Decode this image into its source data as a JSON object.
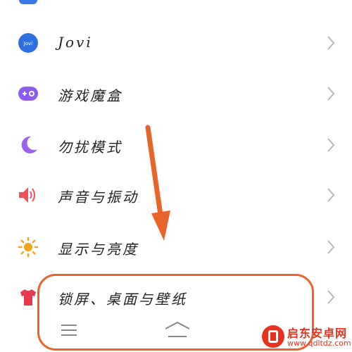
{
  "settings": {
    "items": [
      {
        "label": "Jovi",
        "icon": "jovi-icon"
      },
      {
        "label": "游戏魔盒",
        "icon": "gamepad-icon"
      },
      {
        "label": "勿扰模式",
        "icon": "moon-icon"
      },
      {
        "label": "声音与振动",
        "icon": "speaker-icon"
      },
      {
        "label": "显示与亮度",
        "icon": "sun-icon"
      },
      {
        "label": "锁屏、桌面与壁纸",
        "icon": "tshirt-icon"
      }
    ]
  },
  "annotation": {
    "color": "#e8642a"
  },
  "colors": {
    "jovi": "#2f6fe0",
    "game": "#8a5cf0",
    "moon": "#9b63ee",
    "sound": "#f0505a",
    "sun": "#f7a21c",
    "theme": "#e83a4a"
  },
  "watermark": {
    "title": "启东安卓网",
    "url": "www.qdltdz.com"
  }
}
